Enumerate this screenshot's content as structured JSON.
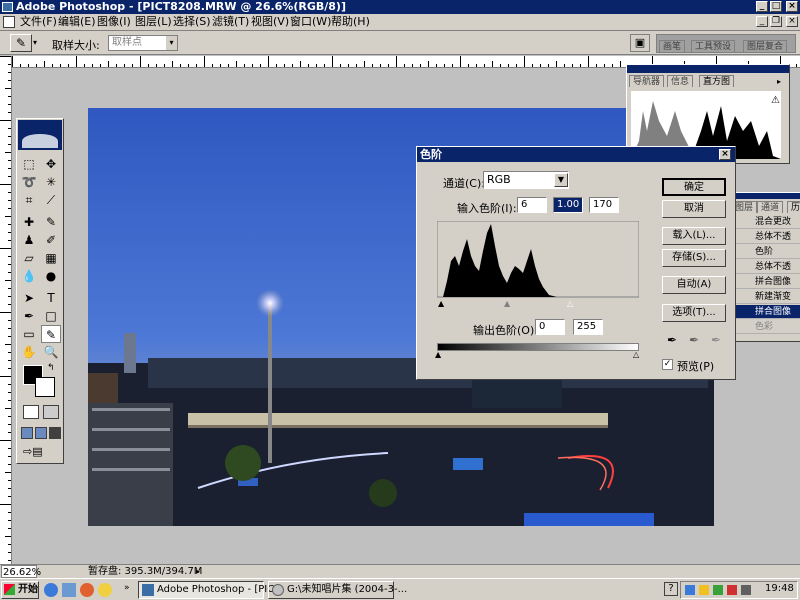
{
  "window": {
    "title": "Adobe Photoshop - [PICT8208.MRW @ 26.6%(RGB/8)]"
  },
  "menu": [
    "文件(F)",
    "编辑(E)",
    "图像(I)",
    "图层(L)",
    "选择(S)",
    "滤镜(T)",
    "视图(V)",
    "窗口(W)",
    "帮助(H)"
  ],
  "options": {
    "sample_label": "取样大小:",
    "sample_value": "取样点"
  },
  "palette_tabs": [
    "画笔",
    "工具预设",
    "图层复合"
  ],
  "navigator": {
    "tabs": [
      "导航器",
      "信息",
      "直方图"
    ]
  },
  "history": {
    "tabs": [
      "图层",
      "通道",
      "历"
    ],
    "items": [
      "混合更改",
      "总体不透",
      "色阶",
      "总体不透",
      "拼合图像",
      "新建渐变",
      "拼合图像",
      "色彩"
    ]
  },
  "levels": {
    "title": "色阶",
    "channel_label": "通道(C):",
    "channel_value": "RGB",
    "input_label": "输入色阶(I):",
    "input_values": [
      "6",
      "1.00",
      "170"
    ],
    "output_label": "输出色阶(O):",
    "output_values": [
      "0",
      "255"
    ],
    "buttons": {
      "ok": "确定",
      "cancel": "取消",
      "load": "载入(L)...",
      "save": "存储(S)...",
      "auto": "自动(A)",
      "options": "选项(T)..."
    },
    "preview_label": "预览(P)",
    "preview_checked": true
  },
  "status": {
    "zoom": "26.62%",
    "scratch": "暂存盘: 395.3M/394.7M"
  },
  "taskbar": {
    "start": "开始",
    "tasks": [
      "Adobe Photoshop - [PIC...",
      "G:\\未知唱片集 (2004-3-..."
    ],
    "clock": "19:48"
  }
}
